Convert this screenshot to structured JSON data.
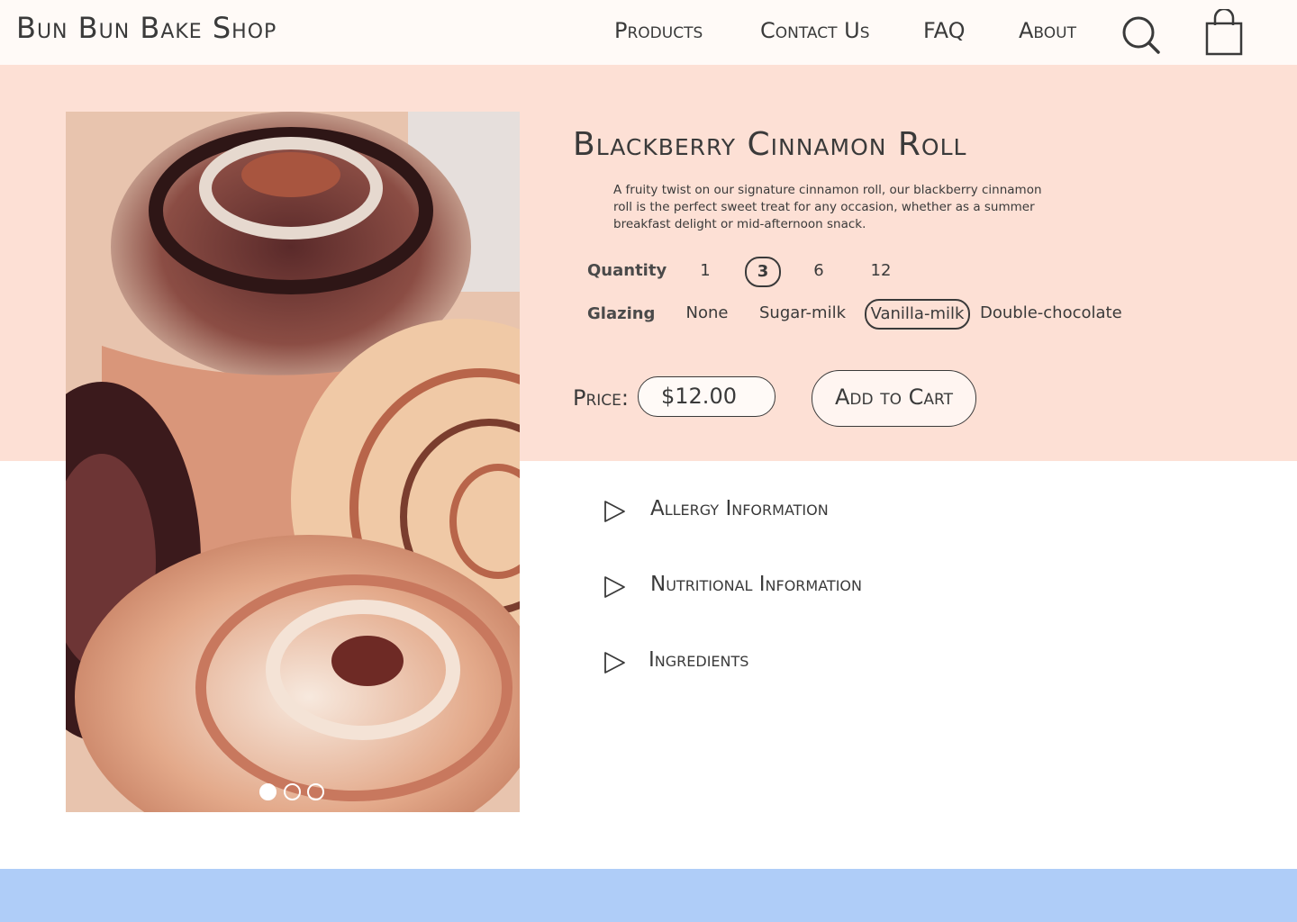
{
  "header": {
    "logo": "Bun Bun Bake Shop",
    "nav": {
      "products": "Products",
      "contact": "Contact Us",
      "faq": "FAQ",
      "about": "About"
    },
    "icons": {
      "search": "search-icon",
      "cart": "shopping-bag-icon"
    }
  },
  "product": {
    "title": "Blackberry Cinnamon Roll",
    "description": "A fruity twist on our signature cinnamon roll, our blackberry cinnamon roll is the perfect sweet treat for any occasion, whether as a summer breakfast delight or mid-afternoon snack.",
    "image": {
      "carousel_count": 3,
      "active_index": 0
    },
    "quantity": {
      "label": "Quantity",
      "options": [
        "1",
        "3",
        "6",
        "12"
      ],
      "selected": "3"
    },
    "glazing": {
      "label": "Glazing",
      "options": [
        "None",
        "Sugar-milk",
        "Vanilla-milk",
        "Double-chocolate"
      ],
      "selected": "Vanilla-milk"
    },
    "price_label": "Price:",
    "price_value": "$12.00",
    "add_to_cart": "Add to Cart"
  },
  "accordions": {
    "allergy": "Allergy Information",
    "nutrition": "Nutritional Information",
    "ingredients": "Ingredients"
  },
  "colors": {
    "header_bg": "#fffaf7",
    "hero_bg": "#fde0d5",
    "footer_bg": "#afcdf8",
    "text": "#3a3a3a"
  }
}
